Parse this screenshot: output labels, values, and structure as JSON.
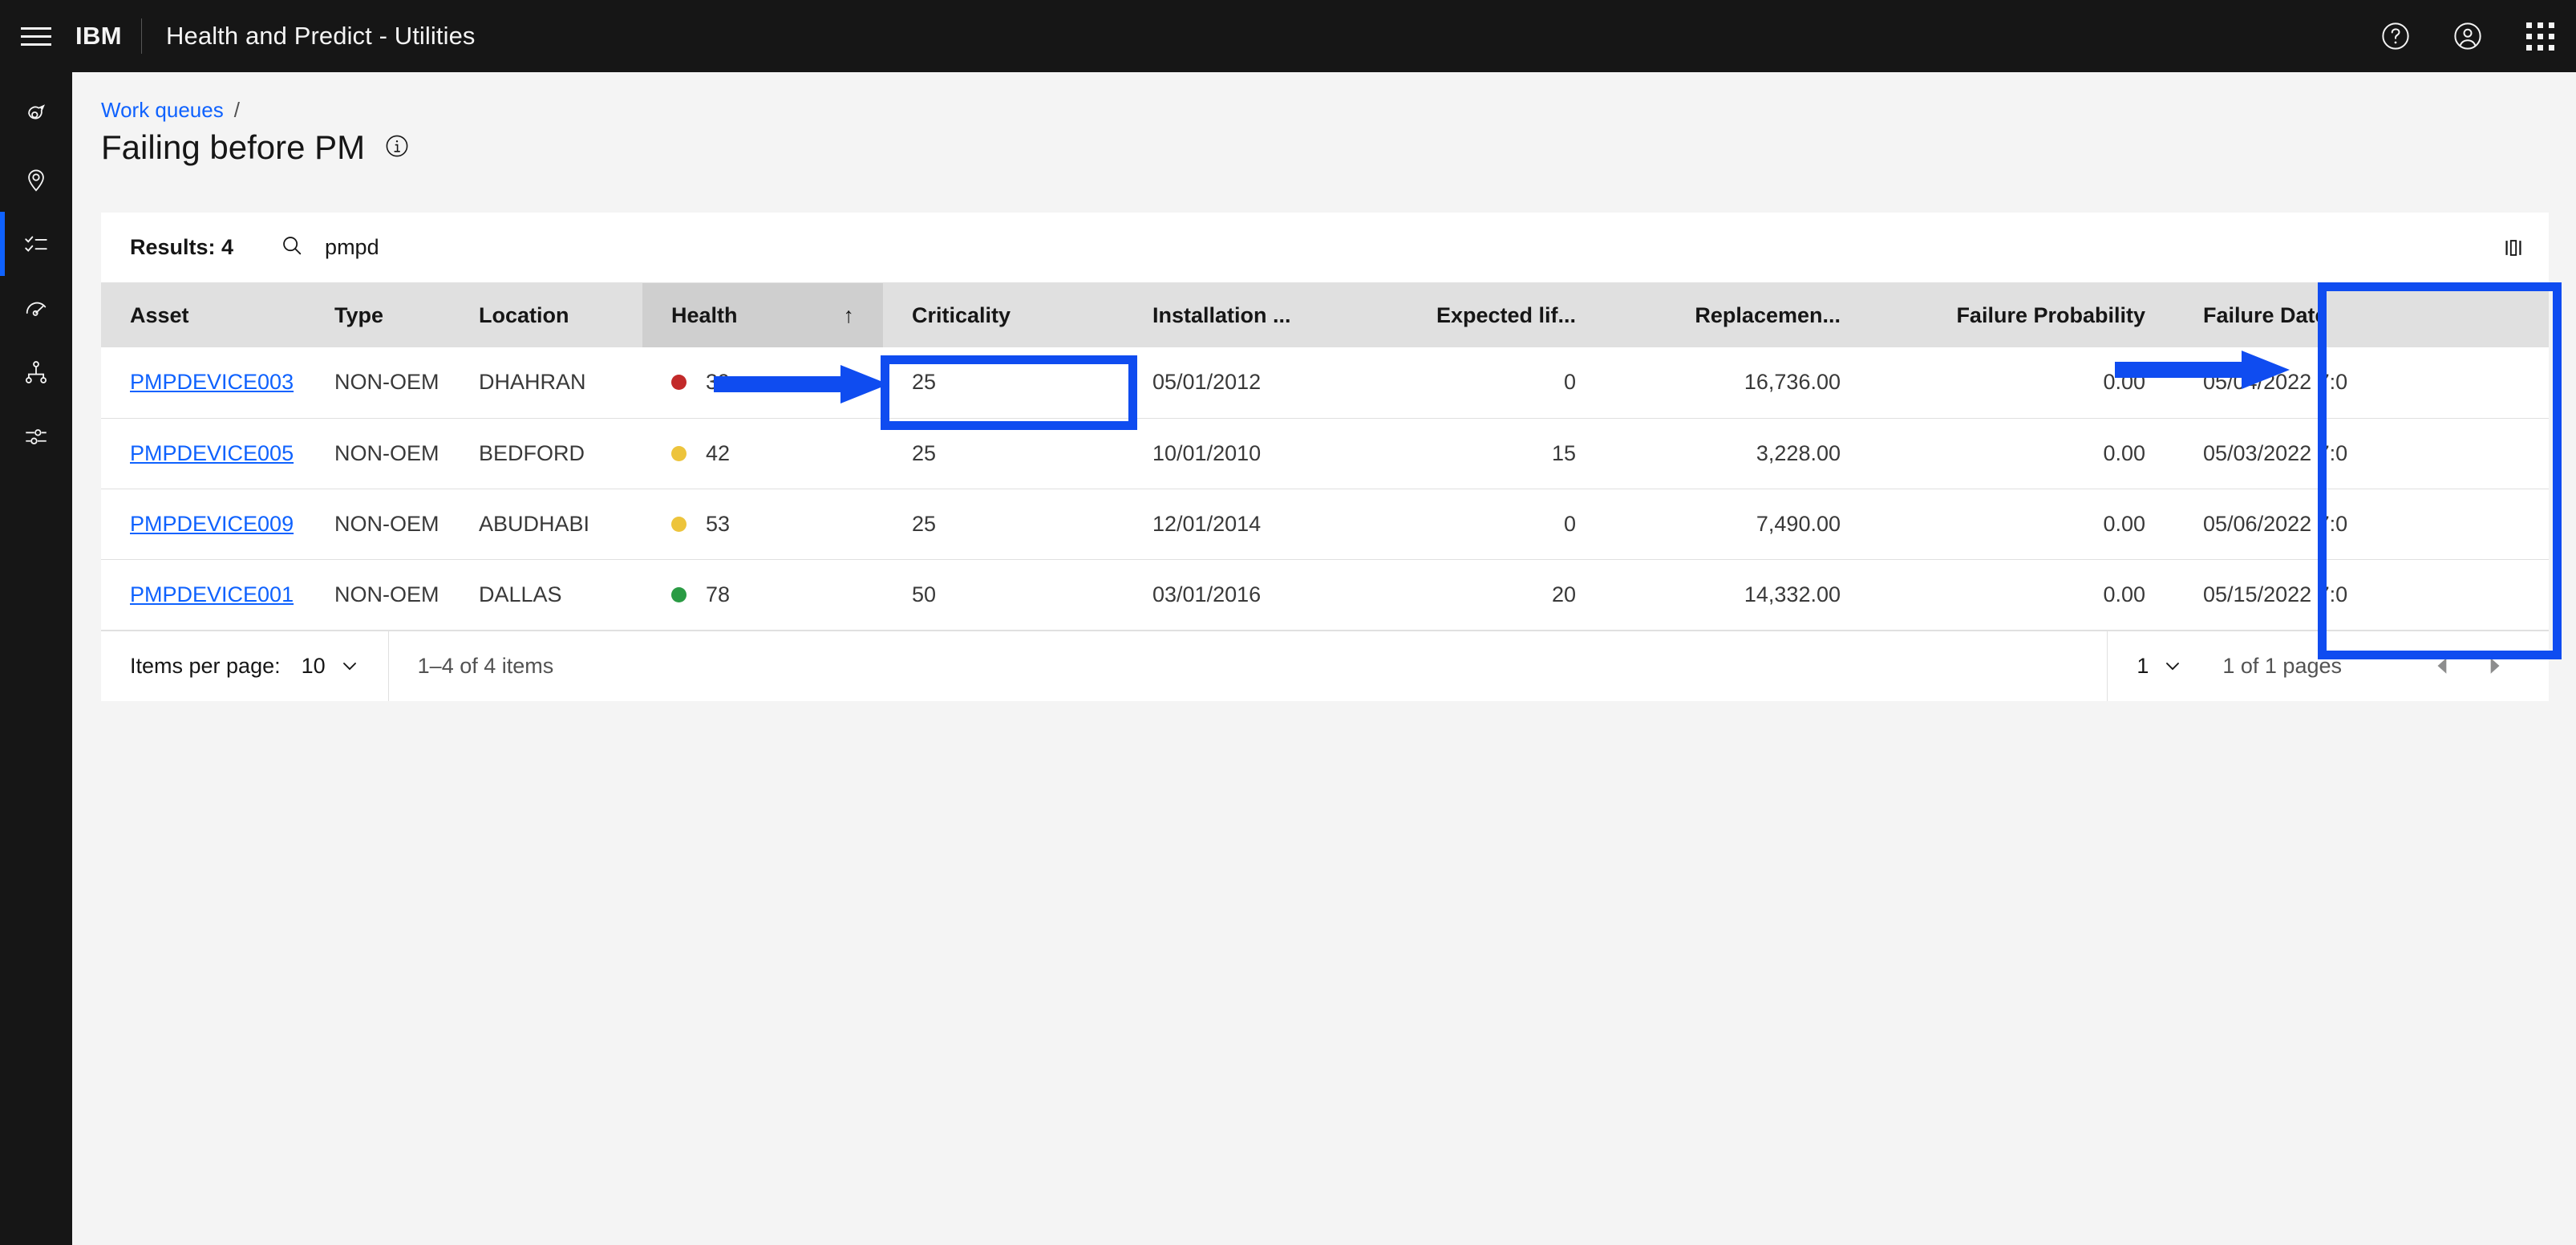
{
  "header": {
    "menu_icon": "hamburger-menu-icon",
    "brand": "IBM",
    "app_title": "Health and Predict - Utilities",
    "help_icon": "help-icon",
    "account_icon": "user-avatar-icon",
    "apps_icon": "app-switcher-icon"
  },
  "sidebar": {
    "items": [
      {
        "icon": "asset-tag-icon",
        "active": false
      },
      {
        "icon": "location-pin-icon",
        "active": false
      },
      {
        "icon": "task-checklist-icon",
        "active": true
      },
      {
        "icon": "gauge-meter-icon",
        "active": false
      },
      {
        "icon": "hierarchy-tree-icon",
        "active": false
      },
      {
        "icon": "settings-sliders-icon",
        "active": false
      }
    ]
  },
  "breadcrumb": {
    "link": "Work queues",
    "separator": "/"
  },
  "page": {
    "title": "Failing before PM",
    "info_icon": "information-icon"
  },
  "toolbar": {
    "results_label": "Results: 4",
    "search_icon": "search-icon",
    "search_value": "pmpd",
    "search_placeholder": "Search",
    "column_settings_icon": "column-layout-icon"
  },
  "table": {
    "columns": [
      {
        "label": "Asset",
        "align": "left",
        "sorted": false
      },
      {
        "label": "Type",
        "align": "left",
        "sorted": false
      },
      {
        "label": "Location",
        "align": "left",
        "sorted": false
      },
      {
        "label": "Health",
        "align": "left",
        "sorted": true,
        "sort_arrow": "↑"
      },
      {
        "label": "Criticality",
        "align": "left",
        "sorted": false
      },
      {
        "label": "Installation ...",
        "align": "left",
        "sorted": false
      },
      {
        "label": "Expected lif...",
        "align": "right",
        "sorted": false
      },
      {
        "label": "Replacemen...",
        "align": "right",
        "sorted": false
      },
      {
        "label": "Failure Probability",
        "align": "right",
        "sorted": false
      },
      {
        "label": "Failure Date",
        "align": "left",
        "sorted": false
      }
    ],
    "rows": [
      {
        "asset": "PMPDEVICE003",
        "type": "NON-OEM",
        "location": "DHAHRAN",
        "health": "39",
        "health_color": "#c22a2a",
        "criticality": "25",
        "installation": "05/01/2012",
        "expected_life": "0",
        "replacement": "16,736.00",
        "failure_probability": "0.00",
        "failure_date": "05/04/2022 7:0"
      },
      {
        "asset": "PMPDEVICE005",
        "type": "NON-OEM",
        "location": "BEDFORD",
        "health": "42",
        "health_color": "#edc43c",
        "criticality": "25",
        "installation": "10/01/2010",
        "expected_life": "15",
        "replacement": "3,228.00",
        "failure_probability": "0.00",
        "failure_date": "05/03/2022 7:0"
      },
      {
        "asset": "PMPDEVICE009",
        "type": "NON-OEM",
        "location": "ABUDHABI",
        "health": "53",
        "health_color": "#edc43c",
        "criticality": "25",
        "installation": "12/01/2014",
        "expected_life": "0",
        "replacement": "7,490.00",
        "failure_probability": "0.00",
        "failure_date": "05/06/2022 7:0"
      },
      {
        "asset": "PMPDEVICE001",
        "type": "NON-OEM",
        "location": "DALLAS",
        "health": "78",
        "health_color": "#2a9b44",
        "criticality": "50",
        "installation": "03/01/2016",
        "expected_life": "20",
        "replacement": "14,332.00",
        "failure_probability": "0.00",
        "failure_date": "05/15/2022 7:0"
      }
    ]
  },
  "pagination": {
    "items_per_page_label": "Items per page:",
    "items_per_page_value": "10",
    "range_label": "1–4 of 4 items",
    "page_value": "1",
    "pages_label": "1 of 1 pages",
    "prev_icon": "caret-left-icon",
    "next_icon": "caret-right-icon"
  },
  "annotations": {
    "accent_color": "#0f4cf0",
    "items": [
      {
        "name": "health-cell-highlight",
        "kind": "box"
      },
      {
        "name": "health-arrow",
        "kind": "arrow"
      },
      {
        "name": "failure-date-highlight",
        "kind": "box"
      },
      {
        "name": "failure-date-arrow",
        "kind": "arrow"
      }
    ]
  }
}
